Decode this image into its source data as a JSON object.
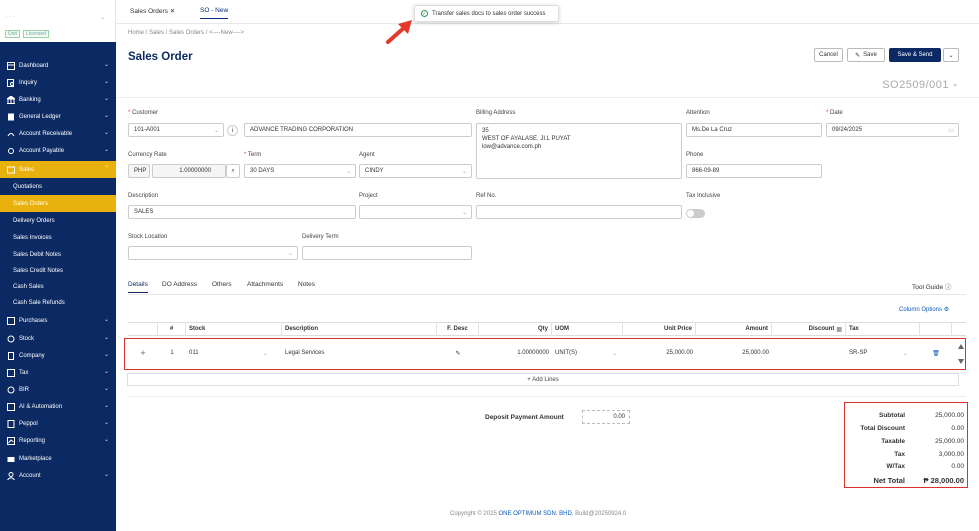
{
  "sidebar": {
    "brand": "·  ·  ·",
    "badges": [
      "Unit",
      "Licensed"
    ],
    "items": [
      {
        "label": "Dashboard",
        "icon": "dashboard-icon"
      },
      {
        "label": "Inquiry",
        "icon": "inquiry-icon"
      },
      {
        "label": "Banking",
        "icon": "bank-icon"
      },
      {
        "label": "General Ledger",
        "icon": "ledger-icon"
      },
      {
        "label": "Account Receivable",
        "icon": "receivable-icon"
      },
      {
        "label": "Account Payable",
        "icon": "payable-icon"
      },
      {
        "label": "Sales",
        "icon": "sales-icon"
      }
    ],
    "sales_sub": [
      "Quotations",
      "Sales Orders",
      "Delivery Orders",
      "Sales Invoices",
      "Sales Debit Notes",
      "Sales Credit Notes",
      "Cash Sales",
      "Cash Sale Refunds"
    ],
    "items2": [
      {
        "label": "Purchases",
        "icon": "purchase-icon"
      },
      {
        "label": "Stock",
        "icon": "stock-icon"
      },
      {
        "label": "Company",
        "icon": "company-icon"
      },
      {
        "label": "Tax",
        "icon": "tax-icon"
      },
      {
        "label": "BIR",
        "icon": "bir-icon"
      },
      {
        "label": "AI & Automation",
        "icon": "ai-icon"
      },
      {
        "label": "Peppol",
        "icon": "peppol-icon"
      },
      {
        "label": "Reporting",
        "icon": "reporting-icon"
      },
      {
        "label": "Marketplace",
        "icon": "marketplace-icon"
      },
      {
        "label": "Account",
        "icon": "account-icon"
      }
    ]
  },
  "tabs": [
    {
      "label": "Sales Orders",
      "close": "✕"
    },
    {
      "label": "SO - New"
    }
  ],
  "toast": "Transfer sales docs to sales order success",
  "breadcrumb": "Home  /  Sales  /  Sales Orders  /  <----New---->",
  "title": "Sales Order",
  "actions": {
    "cancel": "Cancel",
    "save": "Save",
    "save_send": "Save & Send",
    "more": "⌄"
  },
  "doc_no": "SO2509/001",
  "form": {
    "customer_label": "Customer",
    "customer": "101-A001",
    "customer_name": "ADVANCE TRADING CORPORATION",
    "billing_label": "Billing Address",
    "billing_lines": [
      "35",
      "WEST OF AYALASE. JI.L PUYAT",
      "low@advance.com.ph"
    ],
    "attention_label": "Attention",
    "attention": "Ms.De La Cruz",
    "date_label": "Date",
    "date": "09/24/2025",
    "currency_label": "Currency Rate",
    "currency": "PHP",
    "rate": "1.00000000",
    "term_label": "Term",
    "term": "30 DAYS",
    "agent_label": "Agent",
    "agent": "CINDY",
    "phone_label": "Phone",
    "phone": "866-09-89",
    "desc_label": "Description",
    "desc": "SALES",
    "project_label": "Project",
    "project": "",
    "ref_label": "Ref No.",
    "ref": "",
    "taxinc_label": "Tax Inclusive",
    "stockloc_label": "Stock Location",
    "stockloc": "",
    "delterm_label": "Delivery Term",
    "delterm": ""
  },
  "detail_tabs": [
    "Details",
    "DO Address",
    "Others",
    "Attachments",
    "Notes"
  ],
  "tool_guide": "Tool Guide",
  "column_options": "Column Options",
  "table": {
    "headers": [
      "#",
      "Stock",
      "Description",
      "F. Desc",
      "Qty",
      "UOM",
      "Unit Price",
      "Amount",
      "Discount",
      "Tax"
    ],
    "row": {
      "no": "1",
      "stock": "011",
      "description": "Legal Services",
      "qty": "1.00000000",
      "uom": "UNIT(S)",
      "unit_price": "25,000.00",
      "amount": "25,000.00",
      "discount": "",
      "tax": "SR-SP"
    }
  },
  "add_lines": "+ Add Lines",
  "deposit": {
    "label": "Deposit Payment Amount",
    "value": "0.00"
  },
  "totals": [
    {
      "label": "Subtotal",
      "value": "25,000.00"
    },
    {
      "label": "Total Discount",
      "value": "0.00"
    },
    {
      "label": "Taxable",
      "value": "25,000.00"
    },
    {
      "label": "Tax",
      "value": "3,000.00"
    },
    {
      "label": "W/Tax",
      "value": "0.00"
    },
    {
      "label": "Net Total",
      "value": "₱ 28,000.00"
    }
  ],
  "footer": {
    "pre": "Copyright © 2025 ",
    "company": "ONE OPTIMUM SDN. BHD.",
    "post": " Build@20250924.0"
  }
}
